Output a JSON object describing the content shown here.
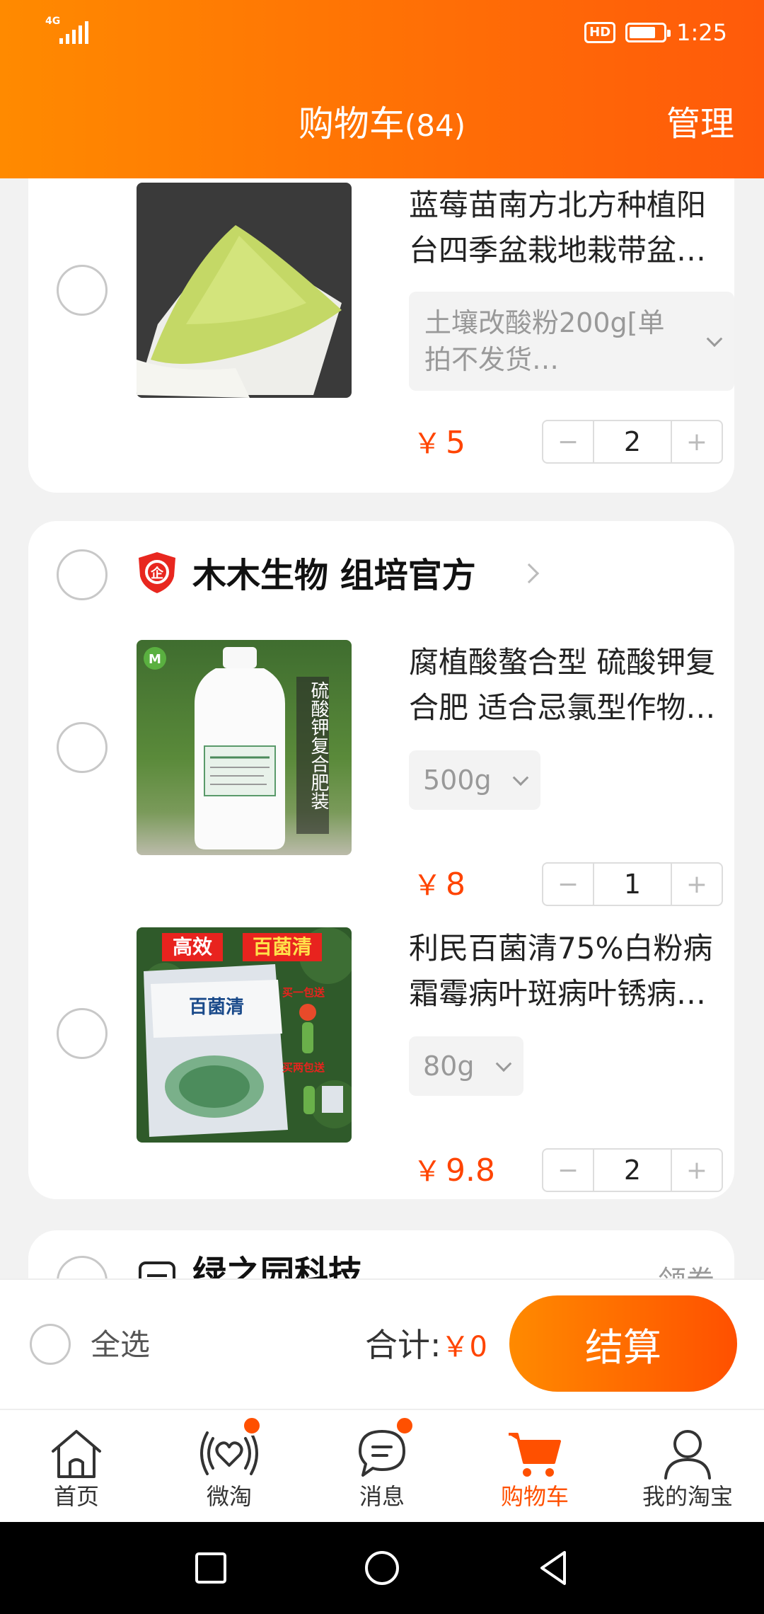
{
  "status_bar": {
    "network": "4G",
    "time": "1:25",
    "hd": "HD"
  },
  "header": {
    "title": "购物车",
    "count": "(84)",
    "manage": "管理"
  },
  "items": [
    {
      "name": "蓝莓苗南方北方种植阳台四季盆栽地栽带盆…",
      "sku": "土壤改酸粉200g[单拍不发货…",
      "currency": "￥",
      "price": "5",
      "qty": "2"
    },
    {
      "name": "腐植酸螯合型 硫酸钾复合肥 适合忌氯型作物…",
      "sku": "500g",
      "currency": "￥",
      "price": "8",
      "qty": "1"
    },
    {
      "name": "利民百菌清75%白粉病霜霉病叶斑病叶锈病…",
      "sku": "80g",
      "currency": "￥",
      "price": "9.8",
      "qty": "2"
    }
  ],
  "shop": {
    "name": "木木生物 组培官方",
    "badge": "企"
  },
  "next_shop": {
    "name": "绿之园科技",
    "coupon": "领券"
  },
  "product_image_text": {
    "bottle_label": "硫酸钾复合肥装",
    "bag_top_left": "高效",
    "bag_top_right": "百菌清",
    "bag_brand": "百菌清",
    "bag_promo_1": "买一包送",
    "bag_promo_2": "买两包送"
  },
  "stepper": {
    "minus": "−",
    "plus": "+"
  },
  "checkout": {
    "select_all": "全选",
    "total_label": "合计:",
    "currency": "￥",
    "total_value": "0",
    "button": "结算"
  },
  "tabs": [
    {
      "label": "首页",
      "icon": "home-icon"
    },
    {
      "label": "微淘",
      "icon": "weitao-icon"
    },
    {
      "label": "消息",
      "icon": "message-icon"
    },
    {
      "label": "购物车",
      "icon": "cart-icon"
    },
    {
      "label": "我的淘宝",
      "icon": "profile-icon"
    }
  ],
  "colors": {
    "brand_orange": "#ff5000",
    "header_start": "#ff8a00",
    "price": "#ff4400"
  }
}
